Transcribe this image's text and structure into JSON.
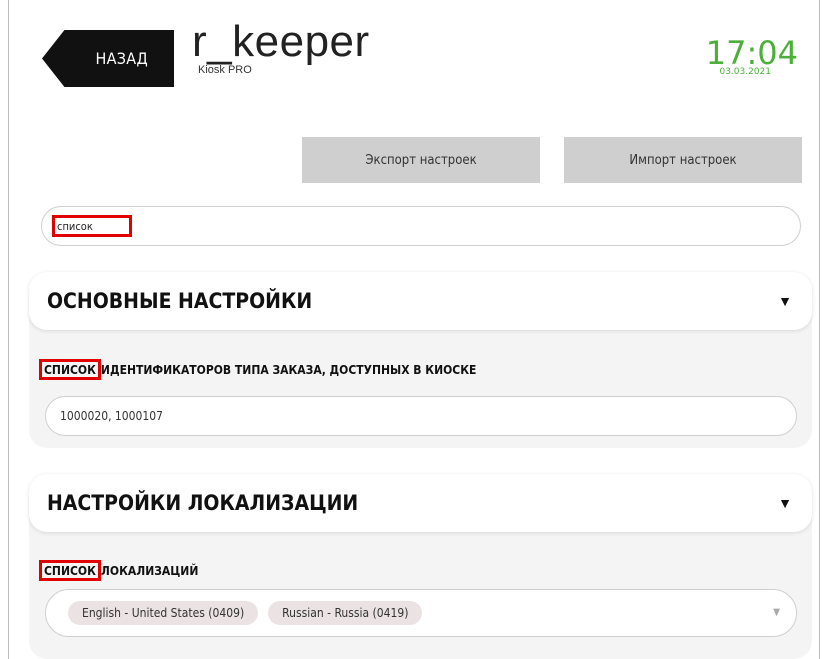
{
  "header": {
    "back_label": "НАЗАД",
    "logo_title": "r_keeper",
    "logo_subtitle": "Kiosk PRO",
    "clock_time": "17:04",
    "clock_date": "03.03.2021"
  },
  "actions": {
    "export_label": "Экспорт настроек",
    "import_label": "Импорт настроек"
  },
  "search": {
    "value": "список"
  },
  "sections": [
    {
      "title": "ОСНОВНЫЕ НАСТРОЙКИ",
      "caret": "▼",
      "field": {
        "label_highlight": "СПИСОК",
        "label_rest": "ИДЕНТИФИКАТОРОВ ТИПА ЗАКАЗА, ДОСТУПНЫХ В КИОСКЕ",
        "value": "1000020, 1000107"
      }
    },
    {
      "title": "НАСТРОЙКИ ЛОКАЛИЗАЦИИ",
      "caret": "▼",
      "field": {
        "label_highlight": "СПИСОК",
        "label_rest": "ЛОКАЛИЗАЦИЙ",
        "chips": [
          "English - United States (0409)",
          "Russian - Russia (0419)"
        ],
        "dropdown_arrow": "▼"
      }
    }
  ],
  "colors": {
    "accent_green": "#4caf3a",
    "highlight_red": "#e00000",
    "back_button": "#111111"
  }
}
